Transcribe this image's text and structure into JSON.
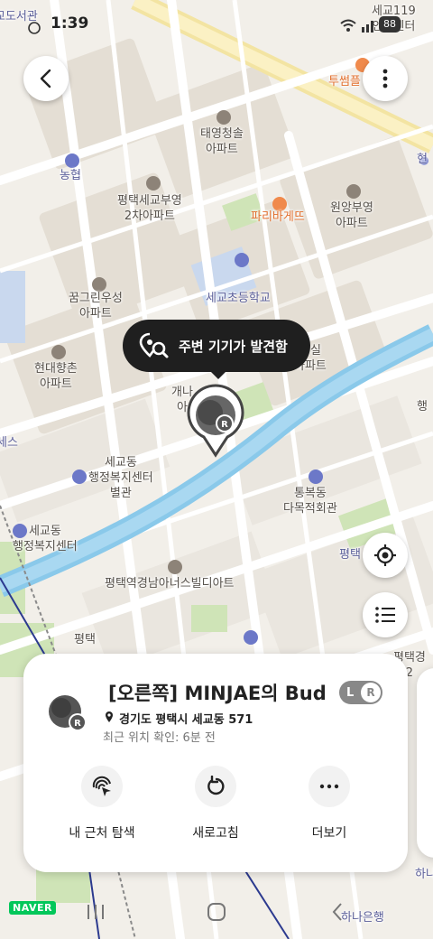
{
  "status_bar": {
    "time": "1:39",
    "battery": "88"
  },
  "map": {
    "labels": [
      {
        "text": "교도서관",
        "cls": "blue"
      },
      {
        "text": "세교119\n안전센터",
        "cls": ""
      },
      {
        "text": "투썸플",
        "cls": "orange"
      },
      {
        "text": "태영청솔\n아파트",
        "cls": ""
      },
      {
        "text": "현",
        "cls": "blue"
      },
      {
        "text": "농협",
        "cls": "blue"
      },
      {
        "text": "평택세교부영\n2차아파트",
        "cls": ""
      },
      {
        "text": "원앙부영\n아파트",
        "cls": ""
      },
      {
        "text": "파리바게뜨",
        "cls": "orange"
      },
      {
        "text": "세교초등학교",
        "cls": "blue"
      },
      {
        "text": "꿈그린우성\n아파트",
        "cls": ""
      },
      {
        "text": "현대향촌\n아파트",
        "cls": ""
      },
      {
        "text": "청실\n아파트",
        "cls": ""
      },
      {
        "text": "개나\n아",
        "cls": ""
      },
      {
        "text": "행",
        "cls": ""
      },
      {
        "text": "세교동\n행정복지센터\n별관",
        "cls": ""
      },
      {
        "text": "통복동\n다목적회관",
        "cls": ""
      },
      {
        "text": "세교동\n행정복지센터",
        "cls": ""
      },
      {
        "text": "평택",
        "cls": "blue"
      },
      {
        "text": "평택역경남아너스빌디아트",
        "cls": ""
      },
      {
        "text": "평택경\n2",
        "cls": ""
      },
      {
        "text": "하나은행",
        "cls": "blue"
      },
      {
        "text": "하나",
        "cls": "blue"
      },
      {
        "text": "평택",
        "cls": ""
      },
      {
        "text": "세스",
        "cls": "blue"
      }
    ]
  },
  "tooltip": {
    "text": "주변 기기가 발견함"
  },
  "marker": {
    "badge": "R"
  },
  "device_card": {
    "title": "[오른쪽] MINJAE의 Buds",
    "address": "경기도 평택시 세교동 571",
    "last_seen": "최근 위치 확인: 6분 전",
    "badge_left": "L",
    "badge_right": "R",
    "avatar_badge": "R",
    "actions": [
      {
        "label": "내 근처 탐색",
        "icon": "nearby-scan-icon"
      },
      {
        "label": "새로고침",
        "icon": "refresh-icon"
      },
      {
        "label": "더보기",
        "icon": "more-horizontal-icon"
      }
    ]
  },
  "brand": {
    "naver": "NAVER"
  },
  "colors": {
    "road_major": "#f7e59a",
    "river": "#7fc8ef",
    "park": "#cfe4b7",
    "block": "#e3ddd3"
  }
}
